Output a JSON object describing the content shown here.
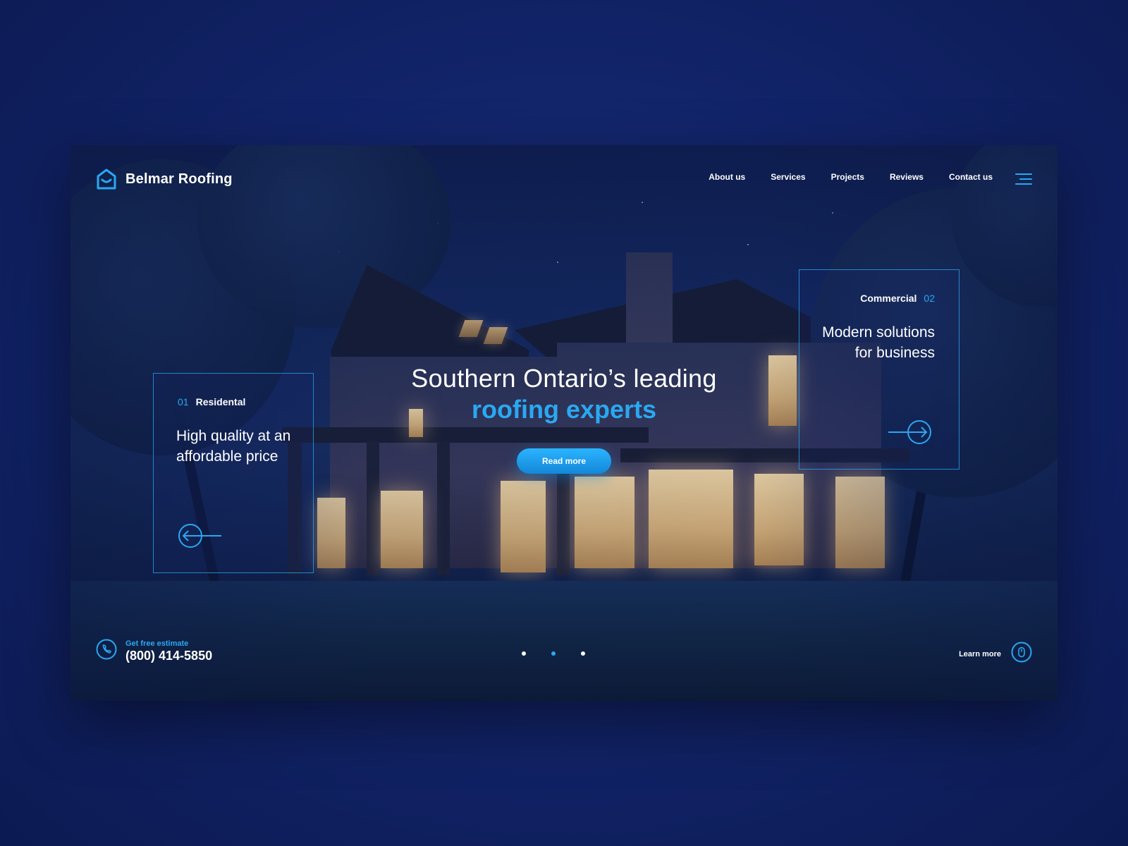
{
  "header": {
    "brand": "Belmar Roofing",
    "nav": [
      "About us",
      "Services",
      "Projects",
      "Reviews",
      "Contact us"
    ]
  },
  "hero": {
    "line1": "Southern Ontario’s leading",
    "line2": "roofing experts",
    "cta": "Read more"
  },
  "cards": {
    "left": {
      "num": "01",
      "label": "Residental",
      "title": "High quality at an affordable price"
    },
    "right": {
      "num": "02",
      "label": "Commercial",
      "title": "Modern solutions for business"
    }
  },
  "footer": {
    "phone_label": "Get free estimate",
    "phone_number": "(800) 414-5850",
    "learn_more": "Learn more",
    "slides": 3,
    "active_slide": 2
  },
  "colors": {
    "accent": "#2aa8f2",
    "background": "#12246a"
  },
  "icons": [
    "house-logo-icon",
    "menu-icon",
    "arrow-left-icon",
    "arrow-right-icon",
    "phone-icon",
    "mouse-scroll-icon"
  ]
}
